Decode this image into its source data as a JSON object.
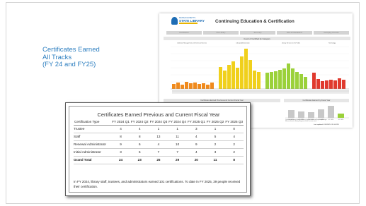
{
  "slide": {
    "title_lines": [
      "Certificates Earned",
      "All Tracks",
      "(FY 24 and FY25)"
    ]
  },
  "dashboard": {
    "logo": {
      "line1": "MASSACHUSETTS",
      "line2": "STATE LIBRARY"
    },
    "title": "Continuing Education & Certification",
    "tabs": [
      "Certification",
      "Pre-Library",
      "Summary",
      "Web & Newsletters",
      "Certifying Courses"
    ],
    "chart_title": "Count of Certified by Category",
    "category_labels": [
      "Collection Management and Technical Services",
      "Library Administration",
      "Library Services to the Public",
      "Technology"
    ],
    "lower_tabs": [
      "Certificates Earned Previous and Current Fiscal Year",
      "Certificates Earned by Fiscal Year"
    ],
    "small_chart_x": [
      "FY 2020",
      "FY 2021",
      "FY 2022",
      "FY 2023",
      "FY 2024",
      "FY 2025"
    ],
    "right_note": "Certificates issued only to library staff who earned by completing a Massachusetts library degree and all course work.",
    "updated": "Last updated: 4/16/2025 2:31:46 PM"
  },
  "table": {
    "title": "Certificates Earned Previous and Current Fiscal Year",
    "columns": [
      "Certification Type",
      "FY 2024 Q1",
      "FY 2024 Q2",
      "FY 2024 Q3",
      "FY 2024 Q4",
      "FY 2025 Q1",
      "FY 2025 Q2",
      "FY 2025 Q3"
    ],
    "rows": [
      {
        "type": "Trustee",
        "values": [
          "4",
          "4",
          "1",
          "1",
          "3",
          "1",
          "0"
        ]
      },
      {
        "type": "Staff",
        "values": [
          "8",
          "8",
          "13",
          "11",
          "4",
          "5",
          "4"
        ]
      },
      {
        "type": "Renewal Administrator",
        "values": [
          "9",
          "6",
          "4",
          "10",
          "9",
          "2",
          "2"
        ]
      },
      {
        "type": "Initial Administrator",
        "values": [
          "3",
          "5",
          "7",
          "7",
          "4",
          "3",
          "2"
        ]
      }
    ],
    "total": {
      "type": "Grand Total",
      "values": [
        "24",
        "23",
        "25",
        "29",
        "20",
        "11",
        "8"
      ]
    },
    "note": "In FY 2024, library staff, trustees, and administrators earned 101 certifications. To date in FY 2025, 39 people received their certification."
  },
  "colors": {
    "title_blue": "#2e7fc0",
    "orange": "#f08a1c",
    "yellow": "#f0d01c",
    "green": "#9bd13a",
    "red": "#e03a2e",
    "grey_bar": "#c8c8c8"
  }
}
